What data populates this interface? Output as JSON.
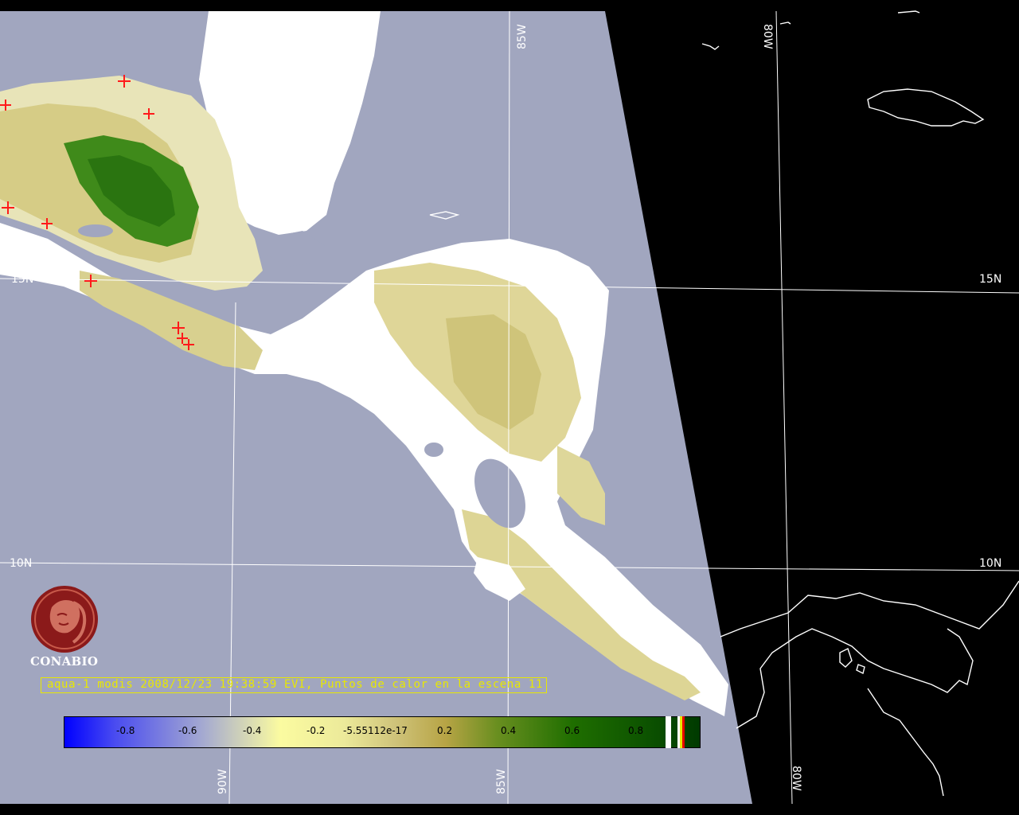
{
  "map": {
    "background_land_color": "#a1a6bf",
    "space_color": "#000000",
    "grid_labels": {
      "lon_top_85": "85W",
      "lon_top_80": "80W",
      "lon_bottom_90": "90W",
      "lon_bottom_85": "85W",
      "lon_bottom_80": "80W",
      "lat_left_15": "15N",
      "lat_right_15": "15N",
      "lat_left_10": "10N",
      "lat_right_10": "10N"
    }
  },
  "logo": {
    "name": "CONABIO",
    "color": "#8b1a1a"
  },
  "caption": {
    "text": "aqua-1 modis 2008/12/23 19:38:59 EVI, Puntos de calor en la escena 11",
    "color": "#e8e800"
  },
  "colorbar": {
    "labels": [
      "-0.8",
      "-0.6",
      "-0.4",
      "-0.2",
      "-5.55112e-17",
      "0.2",
      "0.4",
      "0.6",
      "0.8"
    ],
    "colors": [
      "#0000ff",
      "#a6abd0",
      "#fbfba0",
      "#cfc37a",
      "#1f6e00",
      "#003a00"
    ]
  }
}
